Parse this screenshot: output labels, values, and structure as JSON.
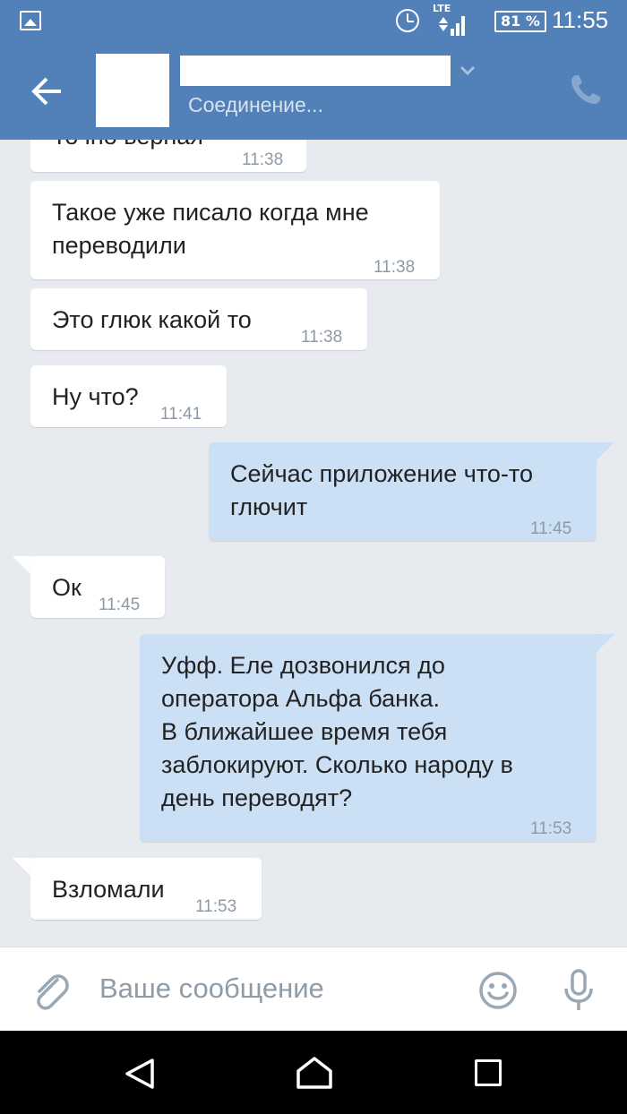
{
  "status_bar": {
    "network_type": "LTE",
    "battery": "81 %",
    "time": "11:55"
  },
  "header": {
    "status_text": "Соединение..."
  },
  "messages": [
    {
      "direction": "in",
      "text": "Точно верная",
      "time": "11:38"
    },
    {
      "direction": "in",
      "text": "Такое уже писало когда мне\nпереводили",
      "time": "11:38"
    },
    {
      "direction": "in",
      "text": "Это глюк какой то",
      "time": "11:38"
    },
    {
      "direction": "in",
      "text": "Ну что?",
      "time": "11:41"
    },
    {
      "direction": "out",
      "text": "Сейчас приложение что-то\nглючит",
      "time": "11:45"
    },
    {
      "direction": "in",
      "text": "Ок",
      "time": "11:45"
    },
    {
      "direction": "out",
      "text": "Уфф. Еле дозвонился до\nоператора Альфа банка.\nВ ближайшее время тебя\nзаблокируют. Сколько народу в\nдень переводят?",
      "time": "11:53"
    },
    {
      "direction": "in",
      "text": "Взломали",
      "time": "11:53"
    }
  ],
  "input": {
    "placeholder": "Ваше сообщение"
  },
  "icons": {
    "back": "arrow-left-icon",
    "call": "phone-icon",
    "attach": "paperclip-icon",
    "emoji": "smiley-icon",
    "mic": "microphone-icon"
  },
  "colors": {
    "header_bg": "#5181b8",
    "chat_bg": "#e7ebf0",
    "incoming_bubble": "#ffffff",
    "outgoing_bubble": "#cce0f5"
  }
}
